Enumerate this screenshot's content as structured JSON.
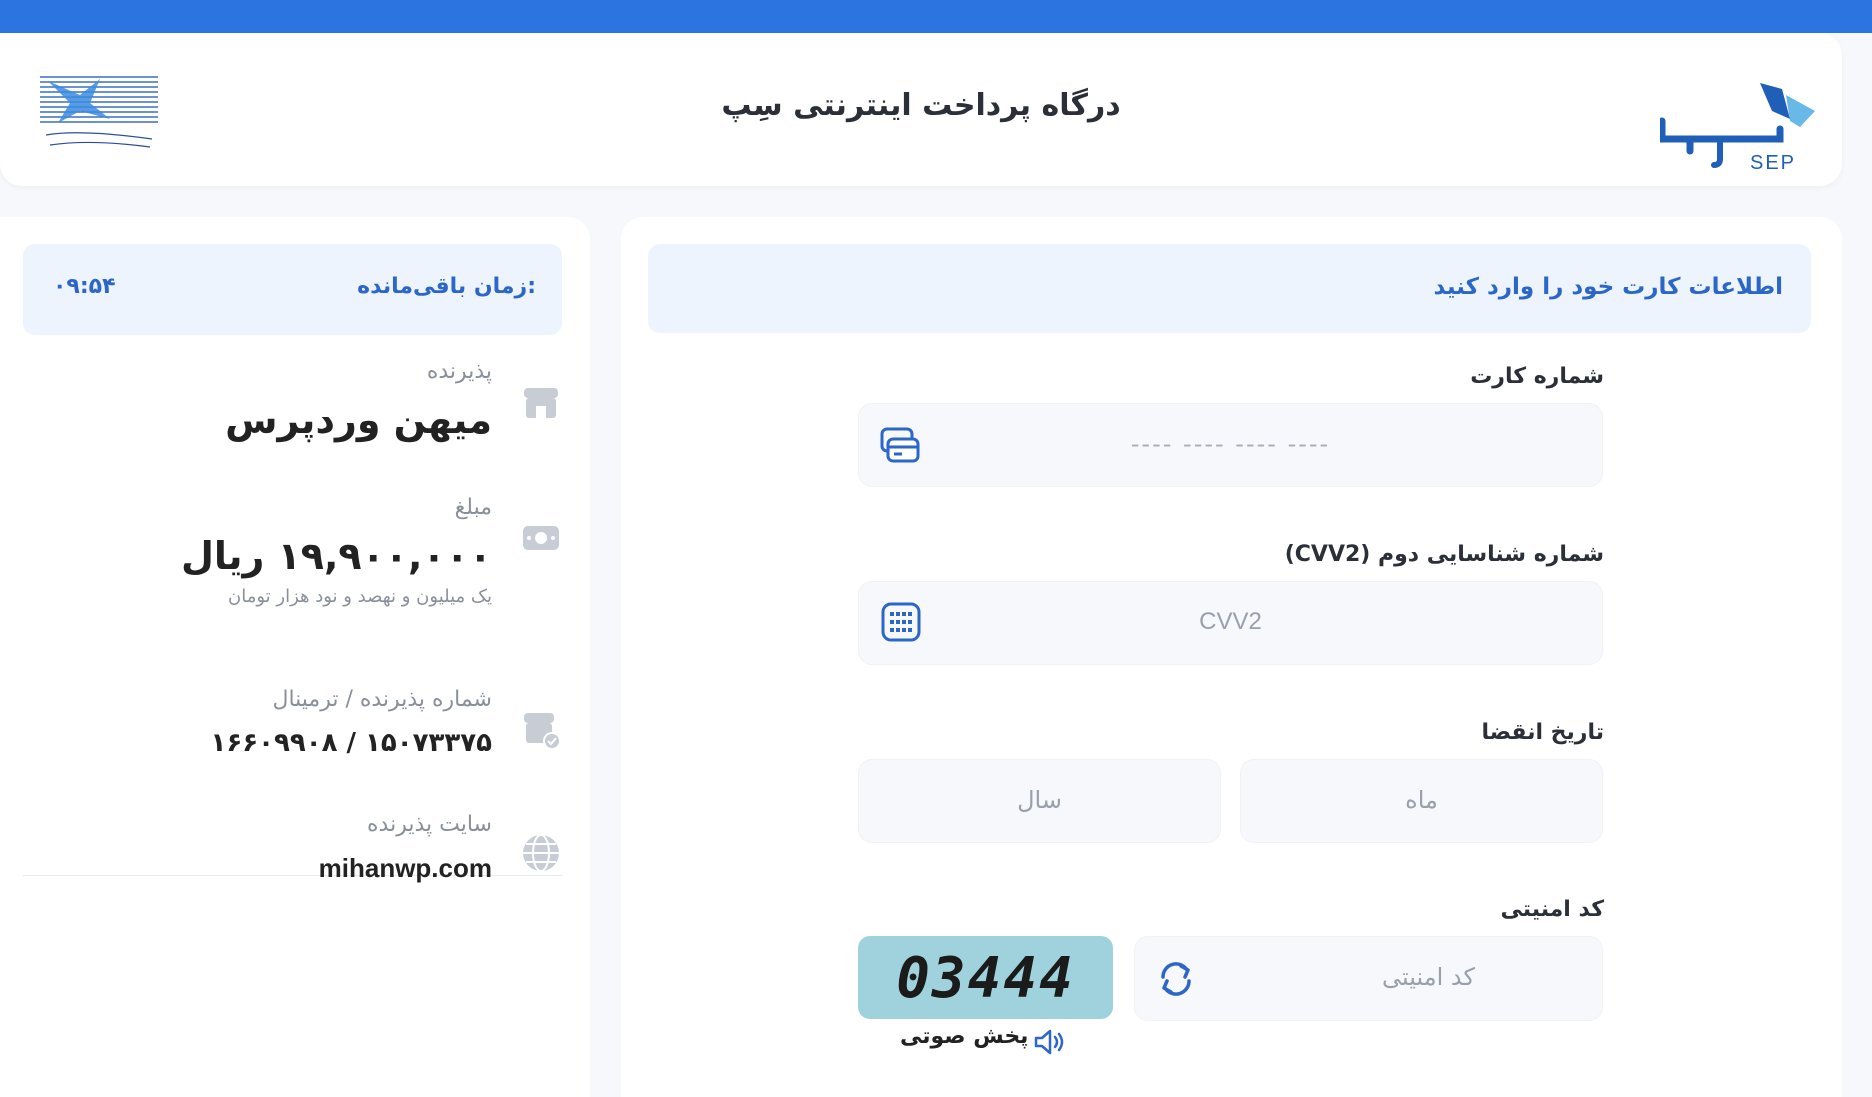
{
  "header": {
    "title": "درگاه پرداخت اینترنتی سِپ",
    "logo_brand_text": "SEP",
    "shaparak_logo_text": "شرکت شبکه الکترونیکی پرداخت کارت شاپرک"
  },
  "timer": {
    "label": "زمان باقی‌مانده:",
    "value": "۰۹:۵۴"
  },
  "merchant": {
    "acceptor_label": "پذیرنده",
    "acceptor_value": "میهن وردپرس",
    "amount_label": "مبلغ",
    "amount_value": "۱۹,۹۰۰,۰۰۰ ریال",
    "amount_words": "یک میلیون و نهصد و نود هزار تومان",
    "terminal_label": "شماره پذیرنده / ترمینال",
    "terminal_value": "۱۵۰۷۳۳۷۵ / ۱۶۶۰۹۹۰۸",
    "site_label": "سایت پذیرنده",
    "site_value": "mihanwp.com"
  },
  "form": {
    "header": "اطلاعات کارت خود را وارد کنید",
    "card_number_label": "شماره کارت",
    "card_number_placeholder": "---- ---- ---- ----",
    "cvv2_label": "شماره شناسایی دوم (CVV2)",
    "cvv2_placeholder": "CVV2",
    "expiry_label": "تاریخ انقضا",
    "month_placeholder": "ماه",
    "year_placeholder": "سال",
    "captcha_label": "کد امنیتی",
    "captcha_placeholder": "کد امنیتی",
    "captcha_image_text": "03444",
    "audio_label": "پخش صوتی"
  },
  "colors": {
    "accent": "#2c74e0",
    "accent_text": "#2c66c8",
    "captcha_bg": "#9fd2dc"
  }
}
